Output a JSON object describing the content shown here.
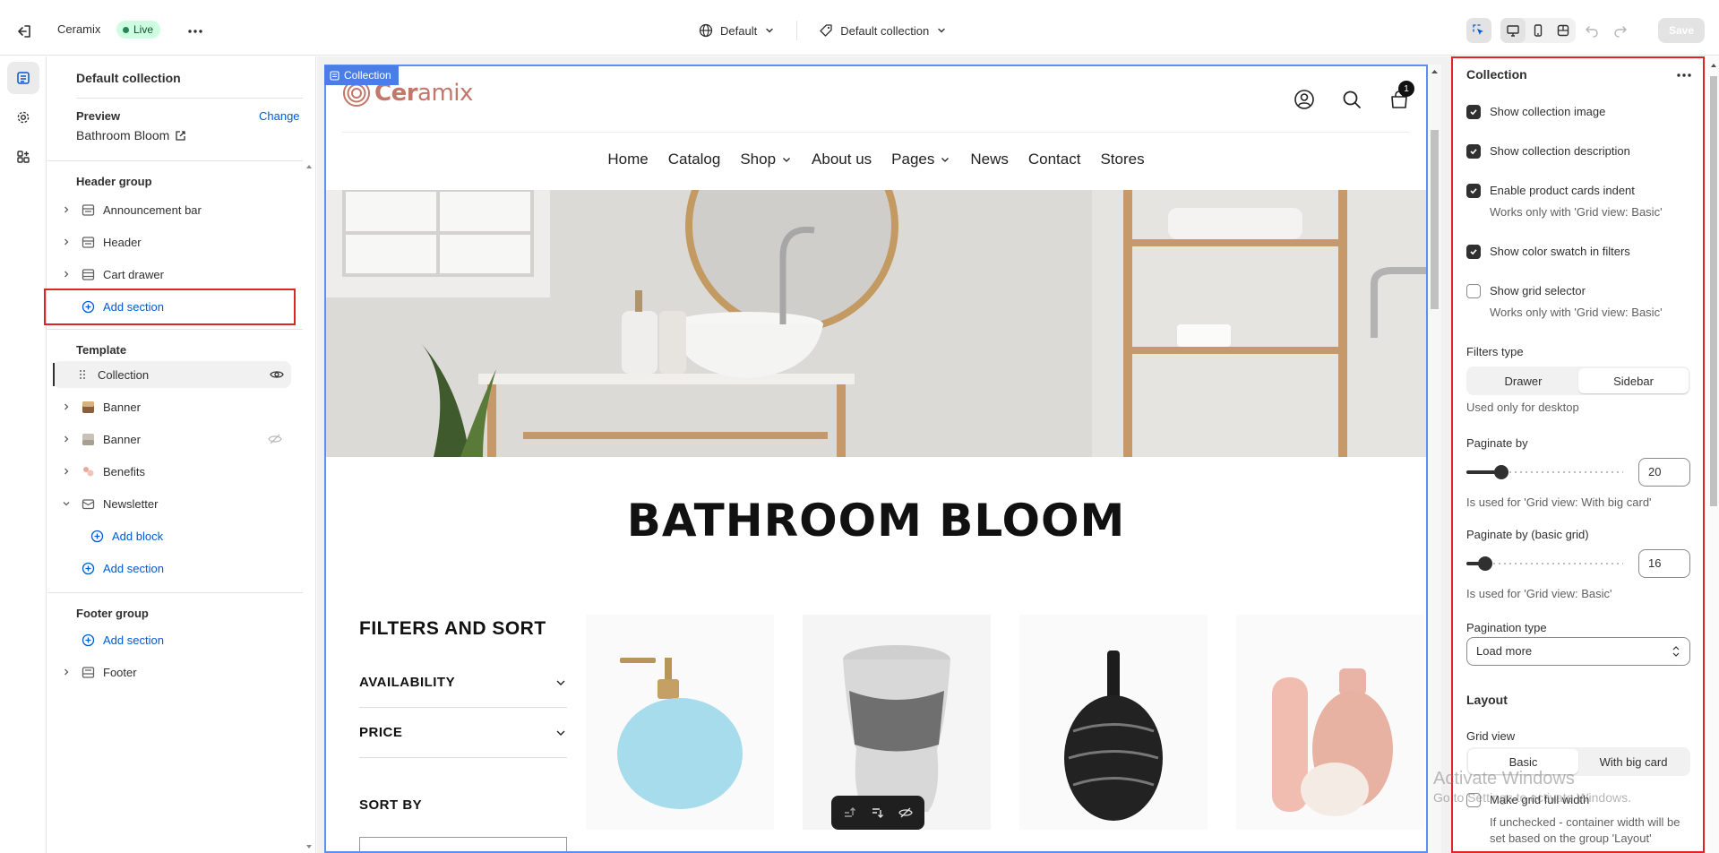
{
  "topbar": {
    "store_name": "Ceramix",
    "status_badge": "Live",
    "theme_select": "Default",
    "template_select": "Default collection",
    "save_label": "Save"
  },
  "sidebar": {
    "title": "Default collection",
    "preview_label": "Preview",
    "change_label": "Change",
    "preview_value": "Bathroom Bloom",
    "header_group": {
      "label": "Header group",
      "items": [
        "Announcement bar",
        "Header",
        "Cart drawer"
      ],
      "add_section": "Add section"
    },
    "template_group": {
      "label": "Template",
      "selected": "Collection",
      "items": [
        "Banner",
        "Banner",
        "Benefits",
        "Newsletter"
      ],
      "add_block": "Add block",
      "add_section": "Add section"
    },
    "footer_group": {
      "label": "Footer group",
      "add_section": "Add section",
      "items": [
        "Footer"
      ]
    }
  },
  "preview": {
    "section_tag": "Collection",
    "logo_initial": "Cer",
    "logo_rest": "amix",
    "cart_count": "1",
    "nav": [
      "Home",
      "Catalog",
      "Shop",
      "About us",
      "Pages",
      "News",
      "Contact",
      "Stores"
    ],
    "collection_title": "BATHROOM BLOOM",
    "filters_title": "FILTERS AND SORT",
    "facets": [
      "AVAILABILITY",
      "PRICE"
    ],
    "sort_by": "SORT BY"
  },
  "settings": {
    "title": "Collection",
    "show_collection_image": {
      "label": "Show collection image",
      "checked": true
    },
    "show_collection_description": {
      "label": "Show collection description",
      "checked": true
    },
    "enable_product_cards_indent": {
      "label": "Enable product cards indent",
      "checked": true,
      "help": "Works only with 'Grid view: Basic'"
    },
    "show_color_swatch": {
      "label": "Show color swatch in filters",
      "checked": true
    },
    "show_grid_selector": {
      "label": "Show grid selector",
      "checked": false,
      "help": "Works only with 'Grid view: Basic'"
    },
    "filters_type": {
      "label": "Filters type",
      "options": [
        "Drawer",
        "Sidebar"
      ],
      "selected": "Sidebar",
      "help": "Used only for desktop"
    },
    "paginate_by": {
      "label": "Paginate by",
      "value": "20",
      "level": 0.22,
      "help": "Is used for 'Grid view: With big card'"
    },
    "paginate_by_basic": {
      "label": "Paginate by (basic grid)",
      "value": "16",
      "level": 0.12,
      "help": "Is used for 'Grid view: Basic'"
    },
    "pagination_type": {
      "label": "Pagination type",
      "value": "Load more"
    },
    "layout_heading": "Layout",
    "grid_view": {
      "label": "Grid view",
      "options": [
        "Basic",
        "With big card"
      ],
      "selected": "Basic"
    },
    "make_grid_full_width": {
      "label": "Make grid full width",
      "checked": false,
      "help": "If unchecked - container width will be set based on the group 'Layout'"
    }
  },
  "watermark": {
    "line1": "Activate Windows",
    "line2": "Go to Settings to activate Windows."
  },
  "colors": {
    "accent_blue": "#005bd3",
    "selection_red": "#e02424",
    "section_blue": "#4a7de6",
    "logo": "#c2776a"
  }
}
